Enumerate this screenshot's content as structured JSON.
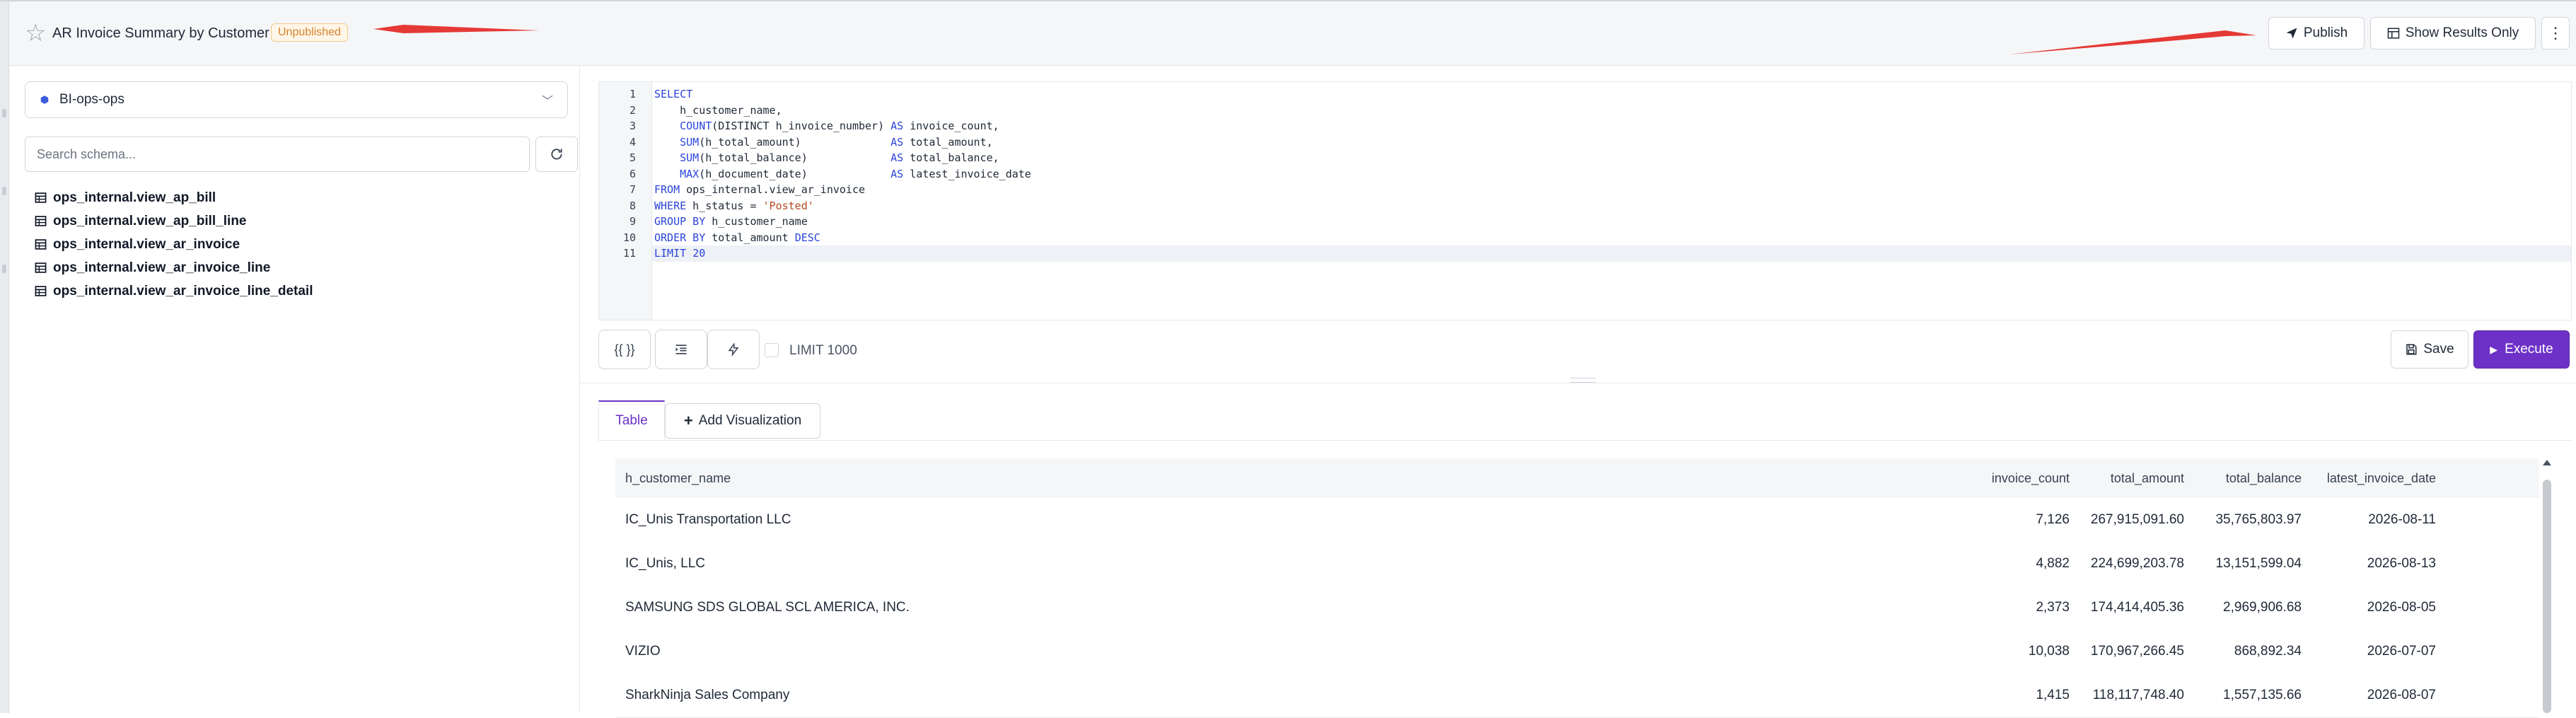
{
  "header": {
    "title": "AR Invoice Summary by Customer",
    "status_badge": "Unpublished",
    "publish_label": "Publish",
    "show_results_label": "Show Results Only"
  },
  "schema_panel": {
    "datasource": "BI-ops-ops",
    "search_placeholder": "Search schema...",
    "tables": [
      "ops_internal.view_ap_bill",
      "ops_internal.view_ap_bill_line",
      "ops_internal.view_ar_invoice",
      "ops_internal.view_ar_invoice_line",
      "ops_internal.view_ar_invoice_line_detail"
    ]
  },
  "editor": {
    "line_numbers": [
      "1",
      "2",
      "3",
      "4",
      "5",
      "6",
      "7",
      "8",
      "9",
      "10",
      "11"
    ],
    "lines": [
      "SELECT",
      "    h_customer_name,",
      "    COUNT(DISTINCT h_invoice_number) AS invoice_count,",
      "    SUM(h_total_amount)              AS total_amount,",
      "    SUM(h_total_balance)             AS total_balance,",
      "    MAX(h_document_date)             AS latest_invoice_date",
      "FROM ops_internal.view_ar_invoice",
      "WHERE h_status = 'Posted'",
      "GROUP BY h_customer_name",
      "ORDER BY total_amount DESC",
      "LIMIT 20"
    ],
    "active_line": 11
  },
  "toolbar": {
    "params_label": "{{ }}",
    "limit_label": "LIMIT 1000",
    "limit_checked": false,
    "save_label": "Save",
    "execute_label": "Execute",
    "accent_color": "#6d31c7"
  },
  "results": {
    "tab_table_label": "Table",
    "add_visualization_label": "Add Visualization",
    "columns": [
      "h_customer_name",
      "invoice_count",
      "total_amount",
      "total_balance",
      "latest_invoice_date"
    ],
    "rows": [
      [
        "IC_Unis Transportation LLC",
        "7,126",
        "267,915,091.60",
        "35,765,803.97",
        "2026-08-11"
      ],
      [
        "IC_Unis, LLC",
        "4,882",
        "224,699,203.78",
        "13,151,599.04",
        "2026-08-13"
      ],
      [
        "SAMSUNG SDS GLOBAL SCL AMERICA, INC.",
        "2,373",
        "174,414,405.36",
        "2,969,906.68",
        "2026-08-05"
      ],
      [
        "VIZIO",
        "10,038",
        "170,967,266.45",
        "868,892.34",
        "2026-07-07"
      ],
      [
        "SharkNinja Sales Company",
        "1,415",
        "118,117,748.40",
        "1,557,135.66",
        "2026-08-07"
      ]
    ]
  },
  "annotations": {
    "arrow_color": "#e53935"
  }
}
